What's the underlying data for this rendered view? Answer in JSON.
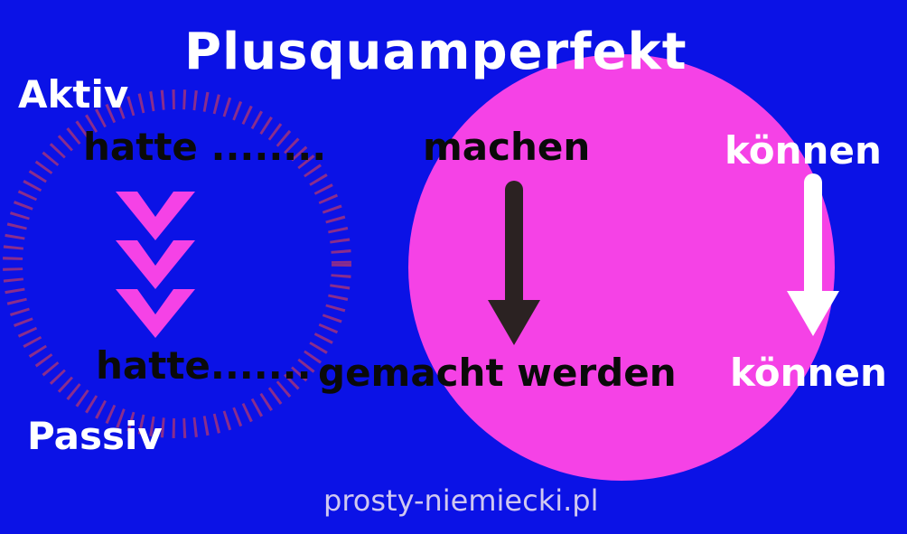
{
  "title": "Plusquamperfekt",
  "labels": {
    "aktiv": "Aktiv",
    "passiv": "Passiv"
  },
  "left_column": {
    "top": "hatte ........",
    "bottom": "hatte.......",
    "chevron_count": 3
  },
  "middle_column": {
    "top": "machen",
    "bottom": "gemacht werden"
  },
  "right_column": {
    "top": "können",
    "bottom": "können"
  },
  "footer": "prosty-niemiecki.pl",
  "colors": {
    "background": "#0b12e6",
    "circle": "#f542e6",
    "chevrons": "#f542e6",
    "dashed_ring": "#8a2d8c",
    "arrow_dark": "#2b2222",
    "arrow_light": "#ffffff"
  },
  "icons": {
    "chevrons": "chevron-down-icon",
    "middle_arrow": "arrow-down-icon",
    "right_arrow": "arrow-down-icon"
  }
}
